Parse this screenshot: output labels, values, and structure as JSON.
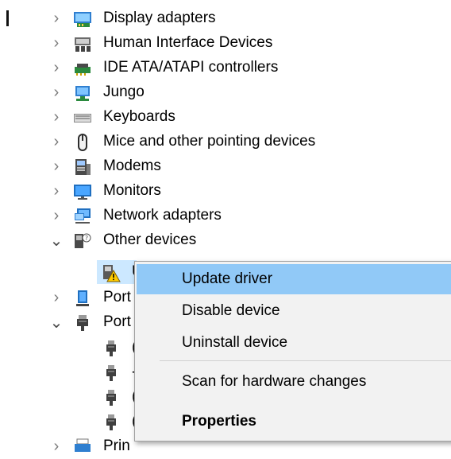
{
  "tree": {
    "items": [
      {
        "label": "Display adapters",
        "chevron": "›",
        "icon": "display-adapter-icon"
      },
      {
        "label": "Human Interface Devices",
        "chevron": "›",
        "icon": "hid-icon"
      },
      {
        "label": "IDE ATA/ATAPI controllers",
        "chevron": "›",
        "icon": "ide-controller-icon"
      },
      {
        "label": "Jungo",
        "chevron": "›",
        "icon": "jungo-icon"
      },
      {
        "label": "Keyboards",
        "chevron": "›",
        "icon": "keyboard-icon"
      },
      {
        "label": "Mice and other pointing devices",
        "chevron": "›",
        "icon": "mouse-icon"
      },
      {
        "label": "Modems",
        "chevron": "›",
        "icon": "modem-icon"
      },
      {
        "label": "Monitors",
        "chevron": "›",
        "icon": "monitor-icon"
      },
      {
        "label": "Network adapters",
        "chevron": "›",
        "icon": "network-adapter-icon"
      },
      {
        "label": "Other devices",
        "chevron": "⌄",
        "icon": "other-devices-icon"
      },
      {
        "label": "U",
        "icon": "warning-device-icon"
      },
      {
        "label": "Port",
        "chevron": "›",
        "icon": "port-icon"
      },
      {
        "label": "Port",
        "chevron": "⌄",
        "icon": "port-usb-icon"
      },
      {
        "label": "(",
        "icon": "usb-plug-icon"
      },
      {
        "label": "-",
        "icon": "usb-plug-icon"
      },
      {
        "label": "(",
        "icon": "usb-plug-icon"
      },
      {
        "label": "(",
        "icon": "usb-plug-icon"
      },
      {
        "label": "Prin",
        "chevron": "›",
        "icon": "printer-icon"
      }
    ]
  },
  "context_menu": {
    "update_driver": "Update driver",
    "disable_device": "Disable device",
    "uninstall_device": "Uninstall device",
    "scan_hardware": "Scan for hardware changes",
    "properties": "Properties"
  },
  "colors": {
    "selection": "#cce8ff",
    "menu_hover": "#91c9f7",
    "menu_bg": "#f2f2f2"
  }
}
